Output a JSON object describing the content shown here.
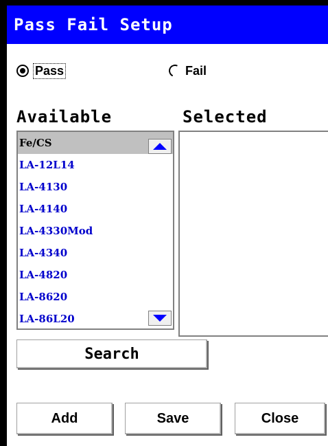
{
  "window": {
    "title": "Pass Fail Setup"
  },
  "mode": {
    "pass_label": "Pass",
    "fail_label": "Fail",
    "selected": "Pass"
  },
  "available": {
    "heading": "Available",
    "items": [
      "Fe/CS",
      "LA-12L14",
      "LA-4130",
      "LA-4140",
      "LA-4330Mod",
      "LA-4340",
      "LA-4820",
      "LA-8620",
      "LA-86L20"
    ],
    "selected_item": "Fe/CS"
  },
  "selected": {
    "heading": "Selected",
    "items": []
  },
  "buttons": {
    "search": "Search",
    "add": "Add",
    "save": "Save",
    "close": "Close"
  },
  "colors": {
    "title_bar": "#0000ff",
    "list_text": "#0000cc",
    "selection": "#c0c0c0",
    "scroll_arrow": "#0000ff"
  }
}
